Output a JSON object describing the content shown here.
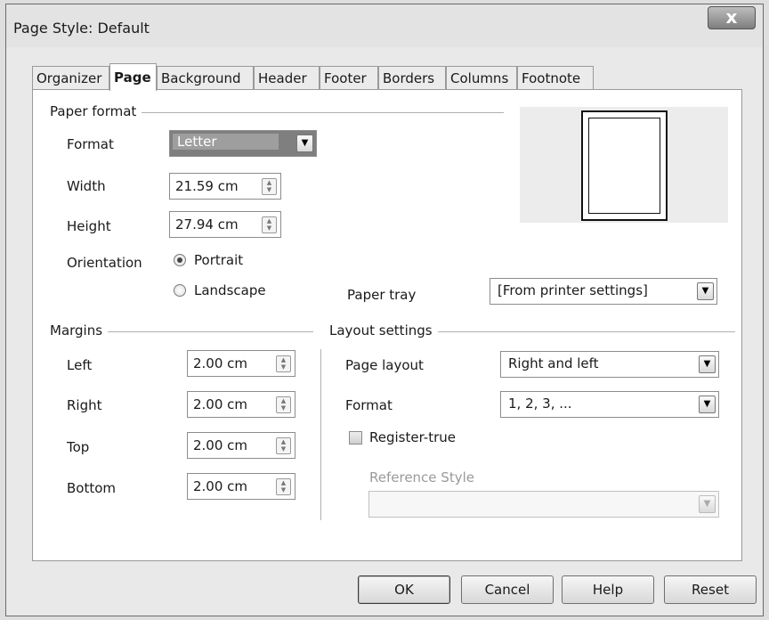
{
  "window": {
    "title": "Page Style: Default",
    "close_glyph": "x"
  },
  "tabs": [
    {
      "label": "Organizer",
      "active": false
    },
    {
      "label": "Page",
      "active": true
    },
    {
      "label": "Background",
      "active": false
    },
    {
      "label": "Header",
      "active": false
    },
    {
      "label": "Footer",
      "active": false
    },
    {
      "label": "Borders",
      "active": false
    },
    {
      "label": "Columns",
      "active": false
    },
    {
      "label": "Footnote",
      "active": false
    }
  ],
  "paper_format": {
    "section": "Paper format",
    "format_label": "Format",
    "format_value": "Letter",
    "width_label": "Width",
    "width_value": "21.59 cm",
    "height_label": "Height",
    "height_value": "27.94 cm",
    "orientation_label": "Orientation",
    "portrait_label": "Portrait",
    "landscape_label": "Landscape",
    "orientation_selected": "Portrait",
    "paper_tray_label": "Paper tray",
    "paper_tray_value": "[From printer settings]"
  },
  "margins": {
    "section": "Margins",
    "left_label": "Left",
    "left_value": "2.00 cm",
    "right_label": "Right",
    "right_value": "2.00 cm",
    "top_label": "Top",
    "top_value": "2.00 cm",
    "bottom_label": "Bottom",
    "bottom_value": "2.00 cm"
  },
  "layout_settings": {
    "section": "Layout settings",
    "page_layout_label": "Page layout",
    "page_layout_value": "Right and left",
    "format_label": "Format",
    "format_value": "1, 2, 3, ...",
    "register_true_label": "Register-true",
    "register_true_checked": false,
    "reference_style_label": "Reference Style",
    "reference_style_value": ""
  },
  "buttons": {
    "ok": "OK",
    "cancel": "Cancel",
    "help": "Help",
    "reset": "Reset"
  },
  "icons": {
    "dropdown": "▼",
    "spin_up": "▲",
    "spin_down": "▼"
  }
}
